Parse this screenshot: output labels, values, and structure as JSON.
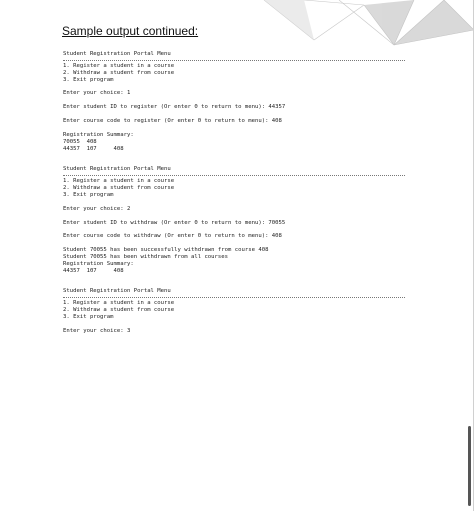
{
  "heading": "Sample output continued:",
  "blocks": [
    {
      "menu_title": "Student Registration Portal Menu",
      "options": [
        "1. Register a student in a course",
        "2. Withdraw a student from course",
        "3. Exit program"
      ],
      "choice": "Enter your choice: 1",
      "prompts": [
        "Enter student ID to register (Or enter 0 to return to menu): 44357",
        "Enter course code to register (Or enter 0 to return to menu): 408"
      ],
      "result_lines": [
        "Registration Summary:",
        "70055  408",
        "44357  107     408"
      ]
    },
    {
      "menu_title": "Student Registration Portal Menu",
      "options": [
        "1. Register a student in a course",
        "2. Withdraw a student from course",
        "3. Exit program"
      ],
      "choice": "Enter your choice: 2",
      "prompts": [
        "Enter student ID to withdraw (Or enter 0 to return to menu): 70055",
        "Enter course code to withdraw (Or enter 0 to return to menu): 408"
      ],
      "result_lines": [
        "Student 70055 has been successfully withdrawn from course 408",
        "Student 70055 has been withdrawn from all courses",
        "Registration Summary:",
        "44357  107     408"
      ]
    },
    {
      "menu_title": "Student Registration Portal Menu",
      "options": [
        "1. Register a student in a course",
        "2. Withdraw a student from course",
        "3. Exit program"
      ],
      "choice": "Enter your choice: 3"
    }
  ]
}
